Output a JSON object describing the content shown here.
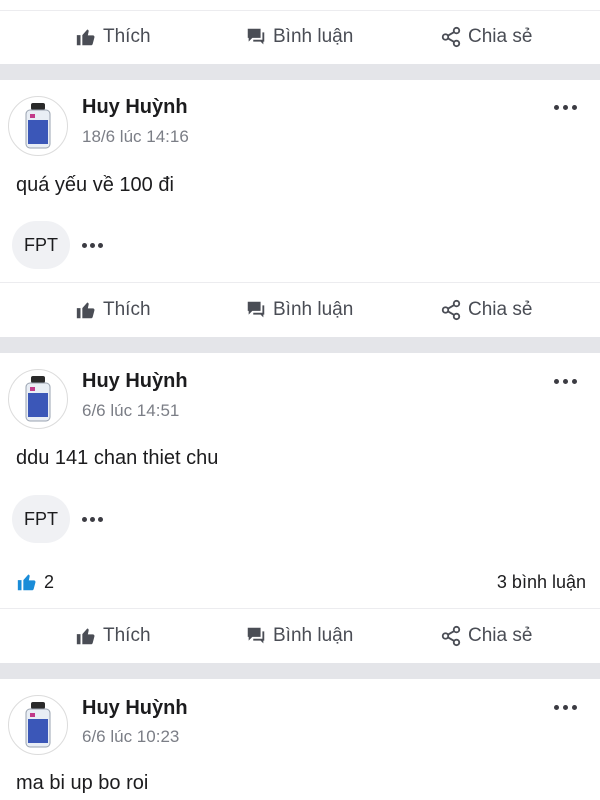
{
  "actions": {
    "like": "Thích",
    "comment": "Bình luận",
    "share": "Chia sẻ"
  },
  "posts": [
    {
      "author": "Huy Huỳnh",
      "time": "18/6 lúc 14:16",
      "content": "quá yếu về 100 đi",
      "tag": "FPT"
    },
    {
      "author": "Huy Huỳnh",
      "time": "6/6 lúc 14:51",
      "content": "ddu 141 chan thiet chu",
      "tag": "FPT",
      "likes": "2",
      "comments": "3 bình luận"
    },
    {
      "author": "Huy Huỳnh",
      "time": "6/6 lúc 10:23",
      "content": "ma bi up bo roi"
    }
  ],
  "colors": {
    "accent": "#1a8cd8",
    "separator": "#e4e5e9",
    "text": "#1c1c1e",
    "muted": "#7b7e86"
  }
}
